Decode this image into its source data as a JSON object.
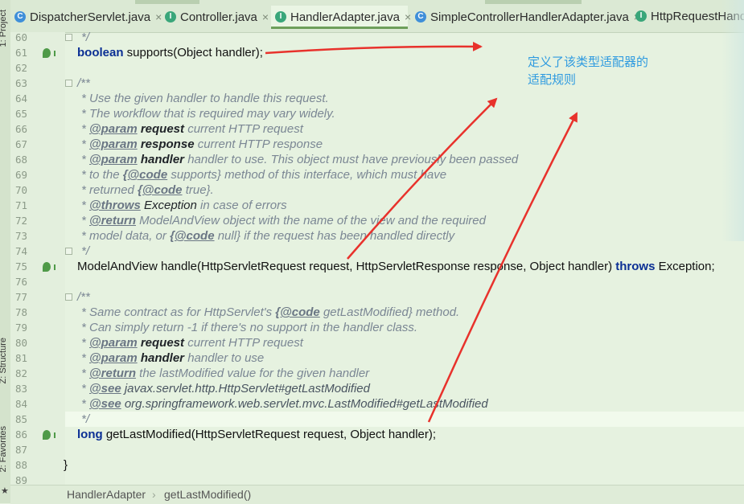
{
  "tabs": [
    {
      "label": "DispatcherServlet.java",
      "icon": "class-icon",
      "active": false
    },
    {
      "label": "Controller.java",
      "icon": "interface-icon",
      "active": false
    },
    {
      "label": "HandlerAdapter.java",
      "icon": "interface-icon",
      "active": true
    },
    {
      "label": "SimpleControllerHandlerAdapter.java",
      "icon": "class-icon",
      "active": false
    },
    {
      "label": "HttpRequestHandler",
      "icon": "interface-icon",
      "active": false
    }
  ],
  "close_glyph": "×",
  "side_tools": {
    "project": "1: Project",
    "structure": "Z: Structure",
    "favorites": "2: Favorites"
  },
  "line_numbers": [
    "60",
    "61",
    "62",
    "63",
    "64",
    "65",
    "66",
    "67",
    "68",
    "69",
    "70",
    "71",
    "72",
    "73",
    "74",
    "75",
    "76",
    "77",
    "78",
    "79",
    "80",
    "81",
    "82",
    "83",
    "84",
    "85",
    "86",
    "87",
    "88",
    "89"
  ],
  "code": {
    "l60": "*/",
    "l61_kw": "boolean",
    "l61_rest": " supports(Object handler);",
    "l63": "/**",
    "l64": "* Use the given handler to handle this request.",
    "l65": "* The workflow that is required may vary widely.",
    "l66_star": "* ",
    "l66_tag": "@param",
    "l66_name": " request",
    "l66_desc": " current HTTP request",
    "l67_star": "* ",
    "l67_tag": "@param",
    "l67_name": " response",
    "l67_desc": " current HTTP response",
    "l68_star": "* ",
    "l68_tag": "@param",
    "l68_name": " handler",
    "l68_desc": " handler to use. This object must have previously been passed",
    "l69_pre": "* to the ",
    "l69_tag": "{@code",
    "l69_post": " supports} method of this interface, which must have",
    "l70_pre": "* returned ",
    "l70_tag": "{@code",
    "l70_post": " true}.",
    "l71_star": "* ",
    "l71_tag": "@throws",
    "l71_name": " Exception",
    "l71_desc": " in case of errors",
    "l72_star": "* ",
    "l72_tag": "@return",
    "l72_desc": " ModelAndView object with the name of the view and the required",
    "l73_pre": "* model data, or ",
    "l73_tag": "{@code",
    "l73_post": " null} if the request has been handled directly",
    "l74": "*/",
    "l75_pre": "ModelAndView handle(HttpServletRequest request, HttpServletResponse response, Object handler) ",
    "l75_kw": "throws",
    "l75_post": " Exception;",
    "l77": "/**",
    "l78_pre": "* Same contract as for HttpServlet's ",
    "l78_tag": "{@code",
    "l78_post": " getLastModified} method.",
    "l79": "* Can simply return -1 if there's no support in the handler class.",
    "l80_star": "* ",
    "l80_tag": "@param",
    "l80_name": " request",
    "l80_desc": " current HTTP request",
    "l81_star": "* ",
    "l81_tag": "@param",
    "l81_name": " handler",
    "l81_desc": " handler to use",
    "l82_star": "* ",
    "l82_tag": "@return",
    "l82_desc": " the lastModified value for the given handler",
    "l83_star": "* ",
    "l83_tag": "@see",
    "l83_ref": " javax.servlet.http.HttpServlet#getLastModified",
    "l84_star": "* ",
    "l84_tag": "@see",
    "l84_ref": " org.springframework.web.servlet.mvc.LastModified#getLastModified",
    "l85": "*/",
    "l86_kw": "long",
    "l86_rest": " getLastModified(HttpServletRequest request, Object handler);",
    "l88": "}"
  },
  "annotation": {
    "line1": "定义了该类型适配器的",
    "line2": "适配规则",
    "color": "#2f9be0",
    "arrow_color": "#e8322c"
  },
  "breadcrumb": {
    "item1": "HandlerAdapter",
    "item2": "getLastModified()"
  }
}
